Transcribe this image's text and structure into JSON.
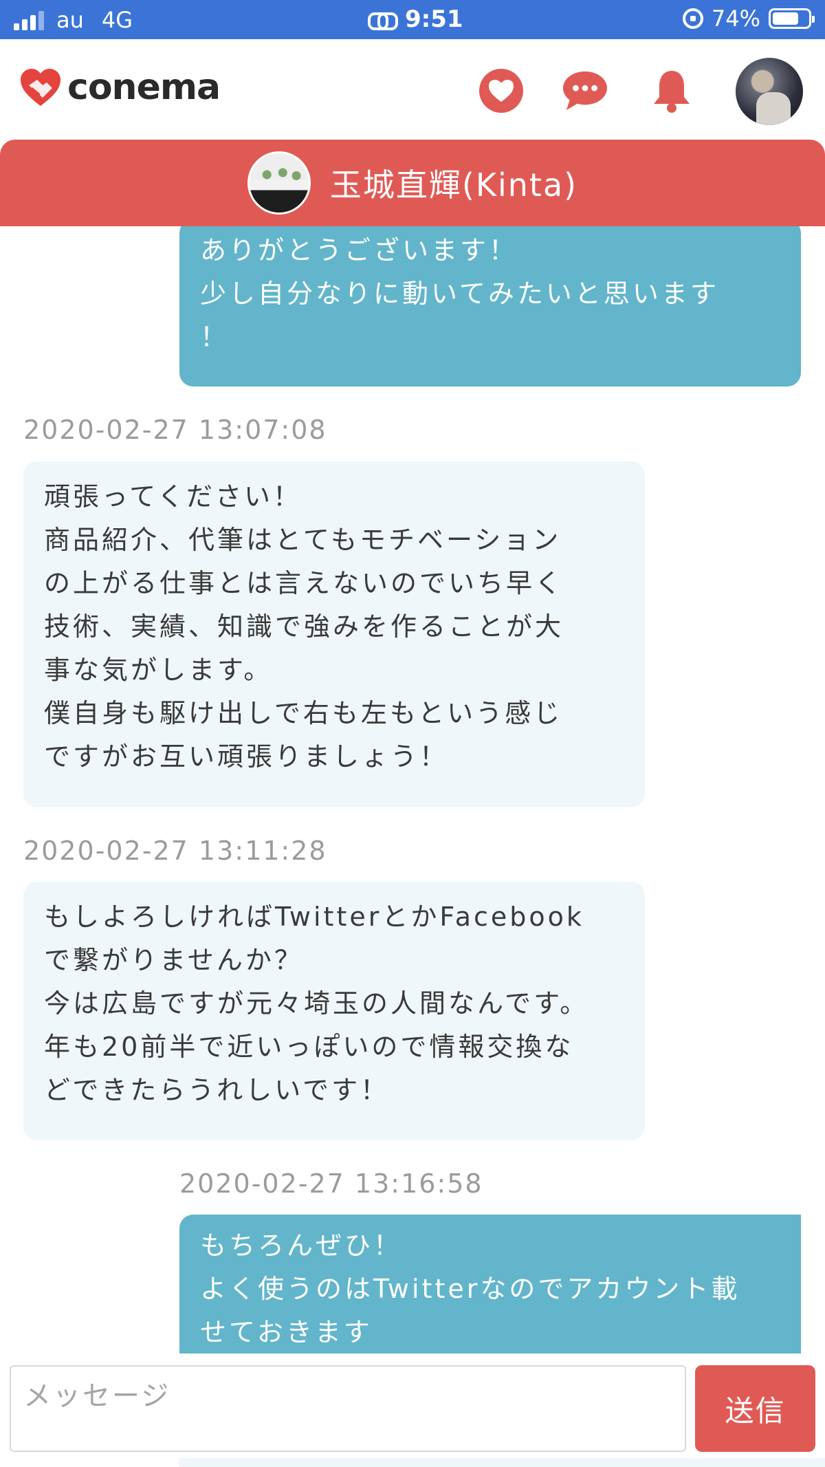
{
  "status_bar": {
    "carrier": "au",
    "network": "4G",
    "time": "9:51",
    "battery_percent": "74%",
    "battery_level": 0.74
  },
  "app": {
    "logo_text": "conema",
    "icons": [
      "heart-icon",
      "chat-bubble-icon",
      "bell-icon"
    ]
  },
  "chat": {
    "partner_name": "玉城直輝(Kinta)"
  },
  "messages": [
    {
      "sender": "me",
      "timestamp": "",
      "text": "ありがとうございます！\n少し自分なりに動いてみたいと思います\n！"
    },
    {
      "sender": "partner",
      "timestamp": "2020-02-27 13:07:08",
      "text": "頑張ってください！\n商品紹介、代筆はとてもモチベーション\nの上がる仕事とは言えないのでいち早く\n技術、実績、知識で強みを作ることが大\n事な気がします。\n僕自身も駆け出しで右も左もという感じ\nですがお互い頑張りましょう！"
    },
    {
      "sender": "partner",
      "timestamp": "2020-02-27 13:11:28",
      "text": "もしよろしければTwitterとかFacebook\nで繋がりませんか？\n今は広島ですが元々埼玉の人間なんです。\n年も20前半で近いっぽいので情報交換な\nどできたらうれしいです！"
    },
    {
      "sender": "me",
      "timestamp": "2020-02-27 13:16:58",
      "text": "もちろんぜひ！\nよく使うのはTwitterなのでアカウント載\nせておきます"
    }
  ],
  "composer": {
    "placeholder": "メッセージ",
    "value": "",
    "send_label": "送信"
  },
  "colors": {
    "status_bar": "#3b74d6",
    "accent_red": "#e05a55",
    "my_bubble": "#62b5cb",
    "their_bubble": "#eff7fb",
    "timestamp_gray": "#9b9b9b"
  }
}
